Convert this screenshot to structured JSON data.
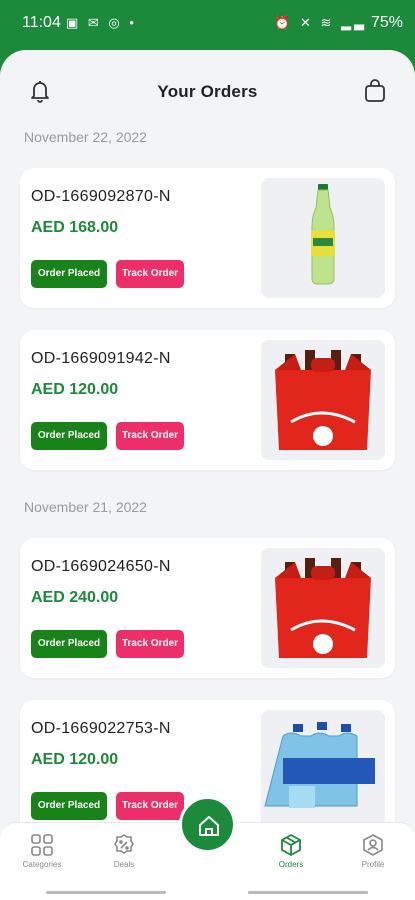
{
  "status_bar": {
    "time": "11:04",
    "left_icons": "▣ ✉ ◎ •",
    "right_icons": "⏰ ✕ ≋ ▂▃",
    "battery": "75%"
  },
  "header": {
    "title": "Your Orders"
  },
  "groups": [
    {
      "date": "November 22, 2022"
    },
    {
      "date": "November 21, 2022"
    }
  ],
  "orders": [
    {
      "id": "OD-1669092870-N",
      "price": "AED 168.00",
      "status_label": "Order Placed",
      "track_label": "Track Order",
      "product_icon": "soda-bottle"
    },
    {
      "id": "OD-1669091942-N",
      "price": "AED 120.00",
      "status_label": "Order Placed",
      "track_label": "Track Order",
      "product_icon": "cola-six-pack"
    },
    {
      "id": "OD-1669024650-N",
      "price": "AED 240.00",
      "status_label": "Order Placed",
      "track_label": "Track Order",
      "product_icon": "cola-six-pack"
    },
    {
      "id": "OD-1669022753-N",
      "price": "AED 120.00",
      "status_label": "Order Placed",
      "track_label": "Track Order",
      "product_icon": "water-bottle-pack"
    }
  ],
  "nav": {
    "categories": "Categories",
    "deals": "Deals",
    "orders": "Orders",
    "profile": "Profile"
  },
  "colors": {
    "brand_green": "#1b8a3a",
    "order_placed": "#178319",
    "track_order": "#ec2f68"
  }
}
